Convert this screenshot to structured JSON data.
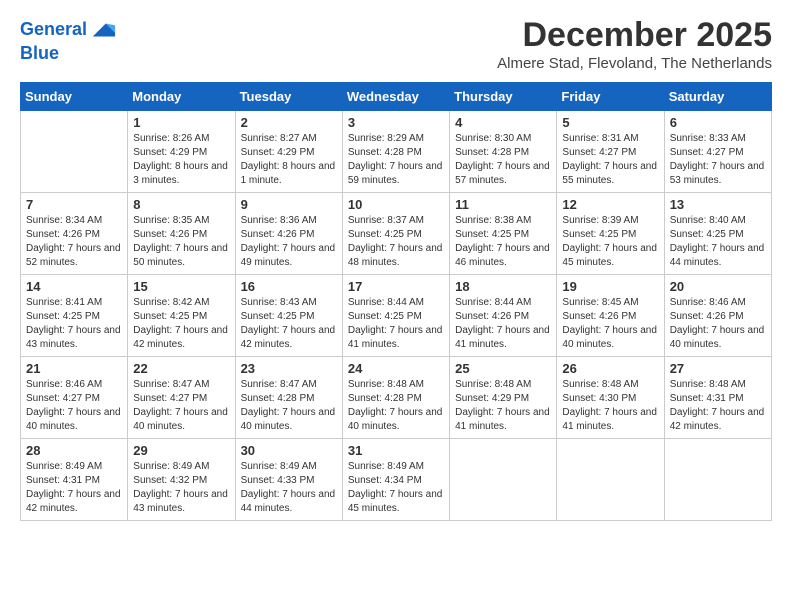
{
  "header": {
    "logo_line1": "General",
    "logo_line2": "Blue",
    "month_title": "December 2025",
    "location": "Almere Stad, Flevoland, The Netherlands"
  },
  "weekdays": [
    "Sunday",
    "Monday",
    "Tuesday",
    "Wednesday",
    "Thursday",
    "Friday",
    "Saturday"
  ],
  "weeks": [
    [
      {
        "day": "",
        "sunrise": "",
        "sunset": "",
        "daylight": ""
      },
      {
        "day": "1",
        "sunrise": "Sunrise: 8:26 AM",
        "sunset": "Sunset: 4:29 PM",
        "daylight": "Daylight: 8 hours and 3 minutes."
      },
      {
        "day": "2",
        "sunrise": "Sunrise: 8:27 AM",
        "sunset": "Sunset: 4:29 PM",
        "daylight": "Daylight: 8 hours and 1 minute."
      },
      {
        "day": "3",
        "sunrise": "Sunrise: 8:29 AM",
        "sunset": "Sunset: 4:28 PM",
        "daylight": "Daylight: 7 hours and 59 minutes."
      },
      {
        "day": "4",
        "sunrise": "Sunrise: 8:30 AM",
        "sunset": "Sunset: 4:28 PM",
        "daylight": "Daylight: 7 hours and 57 minutes."
      },
      {
        "day": "5",
        "sunrise": "Sunrise: 8:31 AM",
        "sunset": "Sunset: 4:27 PM",
        "daylight": "Daylight: 7 hours and 55 minutes."
      },
      {
        "day": "6",
        "sunrise": "Sunrise: 8:33 AM",
        "sunset": "Sunset: 4:27 PM",
        "daylight": "Daylight: 7 hours and 53 minutes."
      }
    ],
    [
      {
        "day": "7",
        "sunrise": "Sunrise: 8:34 AM",
        "sunset": "Sunset: 4:26 PM",
        "daylight": "Daylight: 7 hours and 52 minutes."
      },
      {
        "day": "8",
        "sunrise": "Sunrise: 8:35 AM",
        "sunset": "Sunset: 4:26 PM",
        "daylight": "Daylight: 7 hours and 50 minutes."
      },
      {
        "day": "9",
        "sunrise": "Sunrise: 8:36 AM",
        "sunset": "Sunset: 4:26 PM",
        "daylight": "Daylight: 7 hours and 49 minutes."
      },
      {
        "day": "10",
        "sunrise": "Sunrise: 8:37 AM",
        "sunset": "Sunset: 4:25 PM",
        "daylight": "Daylight: 7 hours and 48 minutes."
      },
      {
        "day": "11",
        "sunrise": "Sunrise: 8:38 AM",
        "sunset": "Sunset: 4:25 PM",
        "daylight": "Daylight: 7 hours and 46 minutes."
      },
      {
        "day": "12",
        "sunrise": "Sunrise: 8:39 AM",
        "sunset": "Sunset: 4:25 PM",
        "daylight": "Daylight: 7 hours and 45 minutes."
      },
      {
        "day": "13",
        "sunrise": "Sunrise: 8:40 AM",
        "sunset": "Sunset: 4:25 PM",
        "daylight": "Daylight: 7 hours and 44 minutes."
      }
    ],
    [
      {
        "day": "14",
        "sunrise": "Sunrise: 8:41 AM",
        "sunset": "Sunset: 4:25 PM",
        "daylight": "Daylight: 7 hours and 43 minutes."
      },
      {
        "day": "15",
        "sunrise": "Sunrise: 8:42 AM",
        "sunset": "Sunset: 4:25 PM",
        "daylight": "Daylight: 7 hours and 42 minutes."
      },
      {
        "day": "16",
        "sunrise": "Sunrise: 8:43 AM",
        "sunset": "Sunset: 4:25 PM",
        "daylight": "Daylight: 7 hours and 42 minutes."
      },
      {
        "day": "17",
        "sunrise": "Sunrise: 8:44 AM",
        "sunset": "Sunset: 4:25 PM",
        "daylight": "Daylight: 7 hours and 41 minutes."
      },
      {
        "day": "18",
        "sunrise": "Sunrise: 8:44 AM",
        "sunset": "Sunset: 4:26 PM",
        "daylight": "Daylight: 7 hours and 41 minutes."
      },
      {
        "day": "19",
        "sunrise": "Sunrise: 8:45 AM",
        "sunset": "Sunset: 4:26 PM",
        "daylight": "Daylight: 7 hours and 40 minutes."
      },
      {
        "day": "20",
        "sunrise": "Sunrise: 8:46 AM",
        "sunset": "Sunset: 4:26 PM",
        "daylight": "Daylight: 7 hours and 40 minutes."
      }
    ],
    [
      {
        "day": "21",
        "sunrise": "Sunrise: 8:46 AM",
        "sunset": "Sunset: 4:27 PM",
        "daylight": "Daylight: 7 hours and 40 minutes."
      },
      {
        "day": "22",
        "sunrise": "Sunrise: 8:47 AM",
        "sunset": "Sunset: 4:27 PM",
        "daylight": "Daylight: 7 hours and 40 minutes."
      },
      {
        "day": "23",
        "sunrise": "Sunrise: 8:47 AM",
        "sunset": "Sunset: 4:28 PM",
        "daylight": "Daylight: 7 hours and 40 minutes."
      },
      {
        "day": "24",
        "sunrise": "Sunrise: 8:48 AM",
        "sunset": "Sunset: 4:28 PM",
        "daylight": "Daylight: 7 hours and 40 minutes."
      },
      {
        "day": "25",
        "sunrise": "Sunrise: 8:48 AM",
        "sunset": "Sunset: 4:29 PM",
        "daylight": "Daylight: 7 hours and 41 minutes."
      },
      {
        "day": "26",
        "sunrise": "Sunrise: 8:48 AM",
        "sunset": "Sunset: 4:30 PM",
        "daylight": "Daylight: 7 hours and 41 minutes."
      },
      {
        "day": "27",
        "sunrise": "Sunrise: 8:48 AM",
        "sunset": "Sunset: 4:31 PM",
        "daylight": "Daylight: 7 hours and 42 minutes."
      }
    ],
    [
      {
        "day": "28",
        "sunrise": "Sunrise: 8:49 AM",
        "sunset": "Sunset: 4:31 PM",
        "daylight": "Daylight: 7 hours and 42 minutes."
      },
      {
        "day": "29",
        "sunrise": "Sunrise: 8:49 AM",
        "sunset": "Sunset: 4:32 PM",
        "daylight": "Daylight: 7 hours and 43 minutes."
      },
      {
        "day": "30",
        "sunrise": "Sunrise: 8:49 AM",
        "sunset": "Sunset: 4:33 PM",
        "daylight": "Daylight: 7 hours and 44 minutes."
      },
      {
        "day": "31",
        "sunrise": "Sunrise: 8:49 AM",
        "sunset": "Sunset: 4:34 PM",
        "daylight": "Daylight: 7 hours and 45 minutes."
      },
      {
        "day": "",
        "sunrise": "",
        "sunset": "",
        "daylight": ""
      },
      {
        "day": "",
        "sunrise": "",
        "sunset": "",
        "daylight": ""
      },
      {
        "day": "",
        "sunrise": "",
        "sunset": "",
        "daylight": ""
      }
    ]
  ]
}
